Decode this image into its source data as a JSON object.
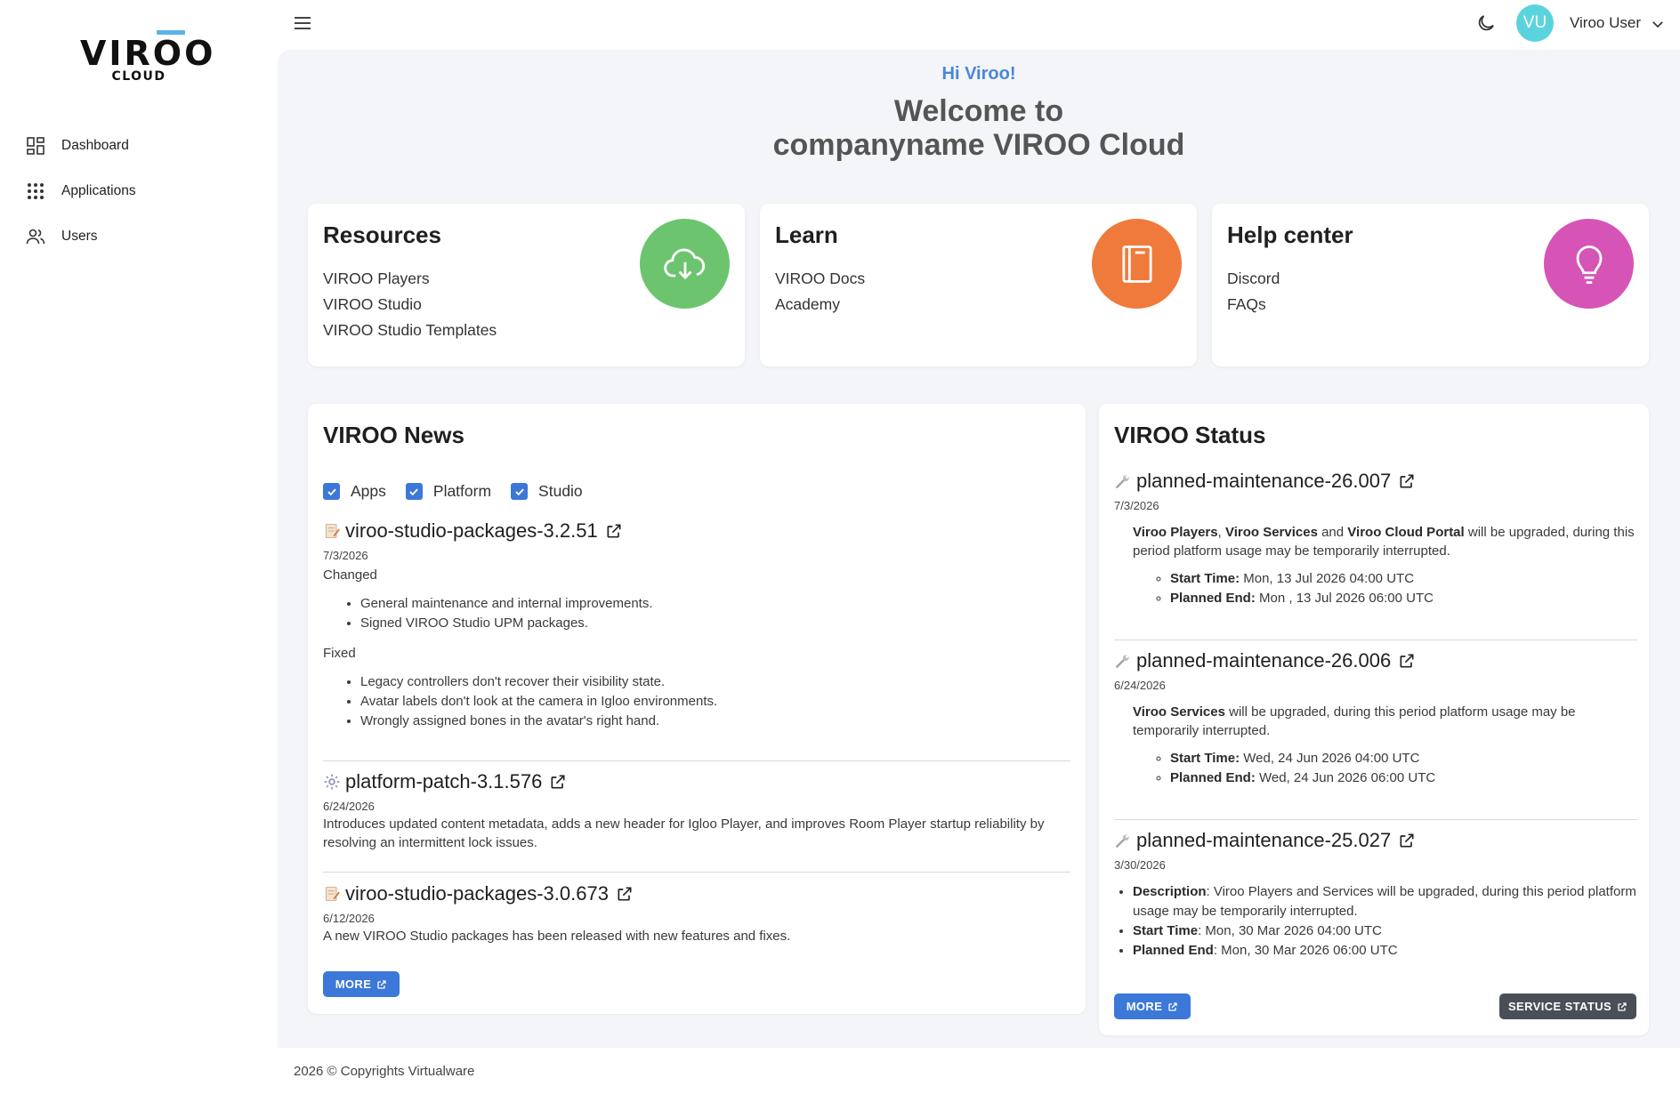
{
  "brand": {
    "logo_main": "VIROO",
    "logo_sub": "CLOUD",
    "accent": "#5ab4e6"
  },
  "sidebar": {
    "items": [
      {
        "label": "Dashboard",
        "icon": "dashboard-icon"
      },
      {
        "label": "Applications",
        "icon": "apps-grid-icon"
      },
      {
        "label": "Users",
        "icon": "users-icon"
      }
    ]
  },
  "header": {
    "avatar_initials": "VU",
    "avatar_color": "#5bd3dc",
    "user_name": "Viroo User"
  },
  "welcome": {
    "greeting": "Hi Viroo!",
    "title_line1": "Welcome to",
    "title_line2": "companyname VIROO Cloud"
  },
  "cards": {
    "resources": {
      "title": "Resources",
      "links": [
        "VIROO Players",
        "VIROO Studio",
        "VIROO Studio Templates"
      ],
      "icon": "cloud-download-icon",
      "color": "#6cc46f"
    },
    "learn": {
      "title": "Learn",
      "links": [
        "VIROO Docs",
        "Academy"
      ],
      "icon": "book-icon",
      "color": "#f07a3c"
    },
    "help": {
      "title": "Help center",
      "links": [
        "Discord",
        "FAQs"
      ],
      "icon": "lightbulb-icon",
      "color": "#d654b6"
    }
  },
  "news": {
    "title": "VIROO News",
    "filters": [
      "Apps",
      "Platform",
      "Studio"
    ],
    "entries": [
      {
        "title": "viroo-studio-packages-3.2.51",
        "date": "7/3/2026",
        "changed_label": "Changed",
        "changed": [
          "General maintenance and internal improvements.",
          "Signed VIROO Studio UPM packages."
        ],
        "fixed_label": "Fixed",
        "fixed": [
          "Legacy controllers don't recover their visibility state.",
          "Avatar labels don't look at the camera in Igloo environments.",
          "Wrongly assigned bones in the avatar's right hand."
        ]
      },
      {
        "title": "platform-patch-3.1.576",
        "date": "6/24/2026",
        "text": "Introduces updated content metadata, adds a new header for Igloo Player, and improves Room Player startup reliability by resolving an intermittent lock issues."
      },
      {
        "title": "viroo-studio-packages-3.0.673",
        "date": "6/12/2026",
        "text": "A new VIROO Studio packages has been released with new features and fixes."
      }
    ],
    "more_label": "MORE"
  },
  "status": {
    "title": "VIROO Status",
    "entries": [
      {
        "title": "planned-maintenance-26.007",
        "date": "7/3/2026",
        "desc_b1": "Viroo Players",
        "desc_sep1": ", ",
        "desc_b2": "Viroo Services",
        "desc_sep2": " and ",
        "desc_b3": "Viroo Cloud Portal",
        "desc_rest": " will be upgraded, during this period platform usage may be temporarily interrupted.",
        "start_label": "Start Time:",
        "start": " Mon, 13 Jul 2026 04:00 UTC",
        "end_label": "Planned End:",
        "end": " Mon , 13 Jul 2026 06:00 UTC"
      },
      {
        "title": "planned-maintenance-26.006",
        "date": "6/24/2026",
        "desc_b1": "Viroo Services",
        "desc_rest": " will be upgraded, during this period platform usage may be temporarily interrupted.",
        "start_label": "Start Time:",
        "start": " Wed, 24 Jun 2026 04:00 UTC",
        "end_label": "Planned End:",
        "end": " Wed, 24 Jun 2026 06:00 UTC"
      },
      {
        "title": "planned-maintenance-25.027",
        "date": "3/30/2026",
        "desc_label": "Description",
        "desc": ": Viroo Players and Services will be upgraded, during this period platform usage may be temporarily interrupted.",
        "start_label": "Start Time",
        "start": ": Mon, 30 Mar 2026 04:00 UTC",
        "end_label": "Planned End",
        "end": ": Mon, 30 Mar 2026 06:00 UTC"
      }
    ],
    "more_label": "MORE",
    "service_label": "SERVICE STATUS"
  },
  "footer": {
    "text": "2026 © Copyrights Virtualware"
  }
}
